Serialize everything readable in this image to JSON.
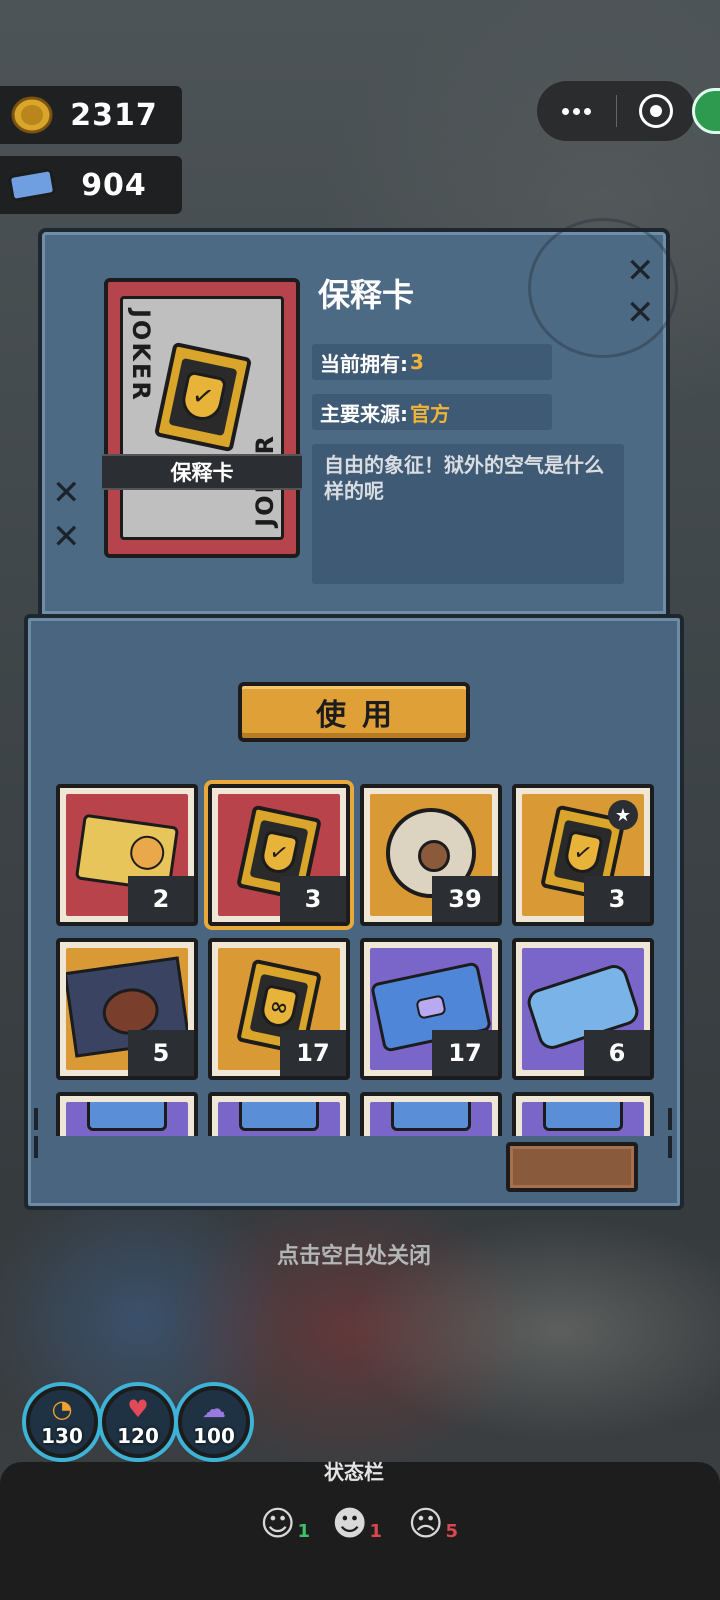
{
  "currency": {
    "coins": "2317",
    "coin_icon": "gold-coin-icon",
    "tickets": "904",
    "ticket_icon": "blue-ticket-icon"
  },
  "item_detail": {
    "card_vertical_text": "JOKER",
    "card_label": "保释卡",
    "title": "保释卡",
    "owned_label": "当前拥有:",
    "owned_value": "3",
    "source_label": "主要来源:",
    "source_value": "官方",
    "description": "自由的象征！狱外的空气是什么样的呢"
  },
  "use_button": "使用",
  "inventory": [
    {
      "icon": "id-card-icon",
      "bg": "red",
      "count": "2",
      "selected": false
    },
    {
      "icon": "bail-card-icon",
      "bg": "red",
      "count": "3",
      "selected": true
    },
    {
      "icon": "film-reel-icon",
      "bg": "orange",
      "count": "39",
      "selected": false
    },
    {
      "icon": "bail-card-star-icon",
      "bg": "orange",
      "count": "3",
      "selected": false
    },
    {
      "icon": "steak-icon",
      "bg": "orange",
      "count": "5",
      "selected": false
    },
    {
      "icon": "ribbon-card-icon",
      "bg": "orange",
      "count": "17",
      "selected": false
    },
    {
      "icon": "toy-ticket-icon",
      "bg": "purple",
      "count": "17",
      "selected": false
    },
    {
      "icon": "blue-ticket-icon",
      "bg": "purple",
      "count": "6",
      "selected": false
    },
    {
      "icon": "partial-item-icon",
      "bg": "purple",
      "count": "",
      "selected": false
    },
    {
      "icon": "partial-item-icon",
      "bg": "purple",
      "count": "",
      "selected": false
    },
    {
      "icon": "partial-item-icon",
      "bg": "purple",
      "count": "",
      "selected": false
    },
    {
      "icon": "partial-item-icon",
      "bg": "purple",
      "count": "",
      "selected": false
    }
  ],
  "close_hint": "点击空白处关闭",
  "stats": [
    {
      "icon": "hunger-icon",
      "value": "130"
    },
    {
      "icon": "heart-icon",
      "value": "120"
    },
    {
      "icon": "brain-icon",
      "value": "100"
    }
  ],
  "status_bar": {
    "title": "状态栏",
    "items": [
      {
        "icon": "love-mood-icon",
        "value": "1",
        "color": "#3fbf6a"
      },
      {
        "icon": "sleep-mood-icon",
        "value": "1",
        "color": "#d9474f"
      },
      {
        "icon": "drama-mask-icon",
        "value": "5",
        "color": "#d9474f"
      }
    ]
  }
}
